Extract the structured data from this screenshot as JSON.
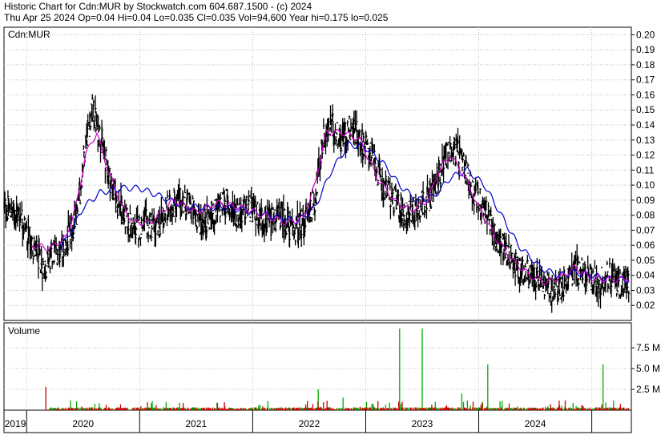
{
  "header": {
    "line1": "Historic Chart for Cdn:MUR by Stockwatch.com 604.687.1500 - (c) 2024",
    "line2": "Thu Apr 25 2024  Op=0.04  Hi=0.04  Lo=0.035  Cl=0.035  Vol=94,600  Year hi=0.175  lo=0.025"
  },
  "chart_data": {
    "type": "line",
    "symbol_label": "Cdn:MUR",
    "volume_label": "Volume",
    "price_axis": {
      "ticks": [
        "0.20",
        "0.19",
        "0.18",
        "0.17",
        "0.16",
        "0.15",
        "0.14",
        "0.13",
        "0.12",
        "0.11",
        "0.10",
        "0.09",
        "0.08",
        "0.07",
        "0.06",
        "0.05",
        "0.04",
        "0.03",
        "0.02"
      ],
      "range": [
        0.01,
        0.205
      ]
    },
    "volume_axis": {
      "ticks": [
        "7.5 M",
        "5.0 M",
        "2.5 M"
      ],
      "range": [
        0,
        10.5
      ]
    },
    "years": [
      "2019",
      "2020",
      "2021",
      "2022",
      "2023",
      "2024"
    ],
    "x_range": [
      2018.8,
      2024.35
    ],
    "colors": {
      "price": "#000000",
      "ma_short": "#cc00cc",
      "ma_long": "#0000cc",
      "vol_up": "#00aa00",
      "vol_down": "#cc0000",
      "grid": "#bbbbbb"
    },
    "price_anchors": [
      [
        2018.8,
        0.085
      ],
      [
        2018.95,
        0.08
      ],
      [
        2019.05,
        0.06
      ],
      [
        2019.15,
        0.045
      ],
      [
        2019.25,
        0.055
      ],
      [
        2019.35,
        0.06
      ],
      [
        2019.45,
        0.08
      ],
      [
        2019.52,
        0.13
      ],
      [
        2019.58,
        0.15
      ],
      [
        2019.66,
        0.13
      ],
      [
        2019.75,
        0.1
      ],
      [
        2019.85,
        0.08
      ],
      [
        2019.95,
        0.07
      ],
      [
        2020.05,
        0.075
      ],
      [
        2020.15,
        0.07
      ],
      [
        2020.25,
        0.085
      ],
      [
        2020.35,
        0.09
      ],
      [
        2020.45,
        0.085
      ],
      [
        2020.55,
        0.075
      ],
      [
        2020.65,
        0.08
      ],
      [
        2020.75,
        0.09
      ],
      [
        2020.85,
        0.08
      ],
      [
        2020.95,
        0.085
      ],
      [
        2021.05,
        0.08
      ],
      [
        2021.15,
        0.075
      ],
      [
        2021.25,
        0.08
      ],
      [
        2021.35,
        0.07
      ],
      [
        2021.45,
        0.075
      ],
      [
        2021.55,
        0.09
      ],
      [
        2021.62,
        0.13
      ],
      [
        2021.7,
        0.14
      ],
      [
        2021.78,
        0.13
      ],
      [
        2021.88,
        0.14
      ],
      [
        2021.95,
        0.13
      ],
      [
        2022.05,
        0.12
      ],
      [
        2022.15,
        0.1
      ],
      [
        2022.25,
        0.09
      ],
      [
        2022.35,
        0.08
      ],
      [
        2022.45,
        0.085
      ],
      [
        2022.55,
        0.09
      ],
      [
        2022.62,
        0.1
      ],
      [
        2022.7,
        0.12
      ],
      [
        2022.78,
        0.125
      ],
      [
        2022.85,
        0.115
      ],
      [
        2022.95,
        0.095
      ],
      [
        2023.05,
        0.085
      ],
      [
        2023.15,
        0.065
      ],
      [
        2023.25,
        0.055
      ],
      [
        2023.35,
        0.045
      ],
      [
        2023.45,
        0.04
      ],
      [
        2023.55,
        0.035
      ],
      [
        2023.65,
        0.03
      ],
      [
        2023.75,
        0.035
      ],
      [
        2023.85,
        0.045
      ],
      [
        2023.95,
        0.04
      ],
      [
        2024.05,
        0.035
      ],
      [
        2024.15,
        0.04
      ],
      [
        2024.25,
        0.035
      ],
      [
        2024.33,
        0.035
      ]
    ],
    "ma_short_anchors": [
      [
        2019.05,
        0.06
      ],
      [
        2019.2,
        0.058
      ],
      [
        2019.35,
        0.065
      ],
      [
        2019.45,
        0.09
      ],
      [
        2019.52,
        0.12
      ],
      [
        2019.62,
        0.135
      ],
      [
        2019.72,
        0.11
      ],
      [
        2019.85,
        0.085
      ],
      [
        2019.95,
        0.075
      ],
      [
        2020.1,
        0.075
      ],
      [
        2020.3,
        0.09
      ],
      [
        2020.5,
        0.082
      ],
      [
        2020.7,
        0.088
      ],
      [
        2020.9,
        0.085
      ],
      [
        2021.1,
        0.08
      ],
      [
        2021.3,
        0.075
      ],
      [
        2021.45,
        0.078
      ],
      [
        2021.55,
        0.1
      ],
      [
        2021.65,
        0.135
      ],
      [
        2021.8,
        0.135
      ],
      [
        2021.95,
        0.13
      ],
      [
        2022.1,
        0.105
      ],
      [
        2022.25,
        0.09
      ],
      [
        2022.4,
        0.083
      ],
      [
        2022.55,
        0.09
      ],
      [
        2022.65,
        0.11
      ],
      [
        2022.75,
        0.12
      ],
      [
        2022.88,
        0.105
      ],
      [
        2023.0,
        0.085
      ],
      [
        2023.15,
        0.065
      ],
      [
        2023.3,
        0.05
      ],
      [
        2023.45,
        0.04
      ],
      [
        2023.6,
        0.035
      ],
      [
        2023.75,
        0.04
      ],
      [
        2023.85,
        0.045
      ],
      [
        2024.0,
        0.038
      ],
      [
        2024.2,
        0.037
      ],
      [
        2024.33,
        0.038
      ]
    ],
    "ma_long_anchors": [
      [
        2019.3,
        0.058
      ],
      [
        2019.4,
        0.07
      ],
      [
        2019.5,
        0.085
      ],
      [
        2019.65,
        0.095
      ],
      [
        2019.85,
        0.098
      ],
      [
        2020.0,
        0.098
      ],
      [
        2020.2,
        0.092
      ],
      [
        2020.4,
        0.086
      ],
      [
        2020.6,
        0.085
      ],
      [
        2020.8,
        0.085
      ],
      [
        2021.0,
        0.082
      ],
      [
        2021.2,
        0.079
      ],
      [
        2021.4,
        0.076
      ],
      [
        2021.55,
        0.085
      ],
      [
        2021.7,
        0.11
      ],
      [
        2021.85,
        0.127
      ],
      [
        2022.0,
        0.125
      ],
      [
        2022.15,
        0.115
      ],
      [
        2022.3,
        0.1
      ],
      [
        2022.45,
        0.09
      ],
      [
        2022.6,
        0.092
      ],
      [
        2022.75,
        0.105
      ],
      [
        2022.9,
        0.11
      ],
      [
        2023.05,
        0.1
      ],
      [
        2023.2,
        0.08
      ],
      [
        2023.35,
        0.06
      ],
      [
        2023.55,
        0.045
      ],
      [
        2023.7,
        0.04
      ],
      [
        2023.85,
        0.042
      ],
      [
        2024.0,
        0.04
      ],
      [
        2024.2,
        0.037
      ],
      [
        2024.33,
        0.037
      ]
    ],
    "volume_spikes": [
      [
        2019.17,
        2.8,
        "down"
      ],
      [
        2021.58,
        2.5,
        "up"
      ],
      [
        2022.3,
        9.8,
        "up"
      ],
      [
        2022.5,
        9.8,
        "up"
      ],
      [
        2023.08,
        5.5,
        "up"
      ],
      [
        2024.1,
        5.5,
        "up"
      ],
      [
        2022.85,
        2.0,
        "up"
      ],
      [
        2021.8,
        1.5,
        "up"
      ]
    ]
  }
}
